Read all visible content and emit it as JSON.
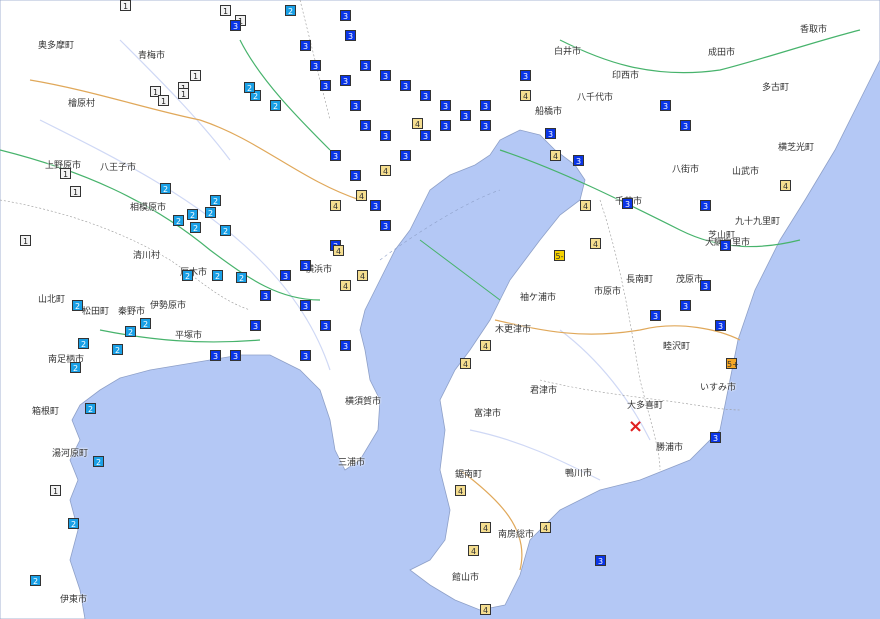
{
  "colors": {
    "sea": "#b4c8f5",
    "land": "#ffffff",
    "int1": "#f2f2f2",
    "int2": "#1aa0e6",
    "int3": "#0a35e6",
    "int4": "#f4dd8f",
    "int5m": "#f5d200",
    "int5p": "#f5a623",
    "epicenter": "#e02020"
  },
  "epicenter_symbol": "×",
  "places": [
    {
      "name": "奥多摩町"
    },
    {
      "name": "青梅市"
    },
    {
      "name": "檜原村"
    },
    {
      "name": "八王子市"
    },
    {
      "name": "上野原市"
    },
    {
      "name": "相模原市"
    },
    {
      "name": "清川村"
    },
    {
      "name": "山北町"
    },
    {
      "name": "松田町"
    },
    {
      "name": "秦野市"
    },
    {
      "name": "南足柄市"
    },
    {
      "name": "箱根町"
    },
    {
      "name": "湯河原町"
    },
    {
      "name": "伊東市"
    },
    {
      "name": "厚木市"
    },
    {
      "name": "伊勢原市"
    },
    {
      "name": "平塚市"
    },
    {
      "name": "横浜市"
    },
    {
      "name": "横須賀市"
    },
    {
      "name": "三浦市"
    },
    {
      "name": "富津市"
    },
    {
      "name": "君津市"
    },
    {
      "name": "木更津市"
    },
    {
      "name": "袖ケ浦市"
    },
    {
      "name": "市原市"
    },
    {
      "name": "千葉市"
    },
    {
      "name": "長南町"
    },
    {
      "name": "茂原市"
    },
    {
      "name": "睦沢町"
    },
    {
      "name": "いすみ市"
    },
    {
      "name": "大多喜町"
    },
    {
      "name": "勝浦市"
    },
    {
      "name": "鴨川市"
    },
    {
      "name": "南房総市"
    },
    {
      "name": "館山市"
    },
    {
      "name": "鋸南町"
    },
    {
      "name": "成田市"
    },
    {
      "name": "印西市"
    },
    {
      "name": "八千代市"
    },
    {
      "name": "船橋市"
    },
    {
      "name": "白井市"
    },
    {
      "name": "八街市"
    },
    {
      "name": "山武市"
    },
    {
      "name": "芝山町"
    },
    {
      "name": "多古町"
    },
    {
      "name": "香取市"
    },
    {
      "name": "横芝光町"
    },
    {
      "name": "九十九里町"
    },
    {
      "name": "大網白里市"
    }
  ],
  "intensity_markers": [
    {
      "label": "1"
    },
    {
      "label": "1"
    },
    {
      "label": "1"
    },
    {
      "label": "1"
    },
    {
      "label": "1"
    },
    {
      "label": "1"
    },
    {
      "label": "1"
    },
    {
      "label": "1"
    },
    {
      "label": "1"
    },
    {
      "label": "1"
    },
    {
      "label": "1"
    },
    {
      "label": "1"
    },
    {
      "label": "2"
    },
    {
      "label": "2"
    },
    {
      "label": "2"
    },
    {
      "label": "2"
    },
    {
      "label": "2"
    },
    {
      "label": "2"
    },
    {
      "label": "2"
    },
    {
      "label": "2"
    },
    {
      "label": "2"
    },
    {
      "label": "2"
    },
    {
      "label": "2"
    },
    {
      "label": "2"
    },
    {
      "label": "2"
    },
    {
      "label": "2"
    },
    {
      "label": "2"
    },
    {
      "label": "2"
    },
    {
      "label": "2"
    },
    {
      "label": "2"
    },
    {
      "label": "2"
    },
    {
      "label": "2"
    },
    {
      "label": "2"
    },
    {
      "label": "2"
    },
    {
      "label": "2"
    },
    {
      "label": "2"
    },
    {
      "label": "3"
    },
    {
      "label": "3"
    },
    {
      "label": "3"
    },
    {
      "label": "3"
    },
    {
      "label": "3"
    },
    {
      "label": "3"
    },
    {
      "label": "3"
    },
    {
      "label": "3"
    },
    {
      "label": "3"
    },
    {
      "label": "3"
    },
    {
      "label": "3"
    },
    {
      "label": "3"
    },
    {
      "label": "3"
    },
    {
      "label": "3"
    },
    {
      "label": "3"
    },
    {
      "label": "3"
    },
    {
      "label": "3"
    },
    {
      "label": "3"
    },
    {
      "label": "3"
    },
    {
      "label": "3"
    },
    {
      "label": "3"
    },
    {
      "label": "3"
    },
    {
      "label": "3"
    },
    {
      "label": "3"
    },
    {
      "label": "3"
    },
    {
      "label": "3"
    },
    {
      "label": "3"
    },
    {
      "label": "3"
    },
    {
      "label": "3"
    },
    {
      "label": "3"
    },
    {
      "label": "3"
    },
    {
      "label": "3"
    },
    {
      "label": "3"
    },
    {
      "label": "3"
    },
    {
      "label": "3"
    },
    {
      "label": "3"
    },
    {
      "label": "3"
    },
    {
      "label": "3"
    },
    {
      "label": "3"
    },
    {
      "label": "3"
    },
    {
      "label": "3"
    },
    {
      "label": "3"
    },
    {
      "label": "3"
    },
    {
      "label": "3"
    },
    {
      "label": "3"
    },
    {
      "label": "3"
    },
    {
      "label": "3"
    },
    {
      "label": "3"
    },
    {
      "label": "3"
    },
    {
      "label": "3"
    },
    {
      "label": "4"
    },
    {
      "label": "4"
    },
    {
      "label": "4"
    },
    {
      "label": "4"
    },
    {
      "label": "4"
    },
    {
      "label": "4"
    },
    {
      "label": "4"
    },
    {
      "label": "4"
    },
    {
      "label": "4"
    },
    {
      "label": "4"
    },
    {
      "label": "4"
    },
    {
      "label": "4"
    },
    {
      "label": "4"
    },
    {
      "label": "4"
    },
    {
      "label": "4"
    },
    {
      "label": "4"
    },
    {
      "label": "4"
    },
    {
      "label": "4"
    },
    {
      "label": "4"
    },
    {
      "label": "5-"
    },
    {
      "label": "5+"
    }
  ]
}
